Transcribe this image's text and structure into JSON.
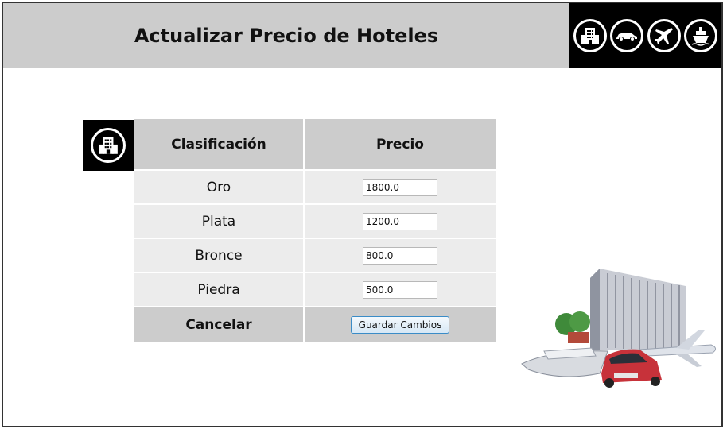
{
  "header": {
    "title": "Actualizar Precio de Hoteles",
    "nav_icons": [
      "hotel-icon",
      "car-icon",
      "plane-icon",
      "ship-icon"
    ]
  },
  "table": {
    "icon": "hotel-icon",
    "headers": {
      "classification": "Clasificación",
      "price": "Precio"
    },
    "rows": [
      {
        "label": "Oro",
        "price": "1800.0"
      },
      {
        "label": "Plata",
        "price": "1200.0"
      },
      {
        "label": "Bronce",
        "price": "800.0"
      },
      {
        "label": "Piedra",
        "price": "500.0"
      }
    ],
    "cancel_label": "Cancelar",
    "save_label": "Guardar Cambios"
  },
  "colors": {
    "header_bg": "#cccccc",
    "icon_bar_bg": "#000000",
    "row_bg": "#ececec",
    "button_border": "#3a8cc7"
  },
  "illustration": "hotel-car-plane-ship-illustration"
}
